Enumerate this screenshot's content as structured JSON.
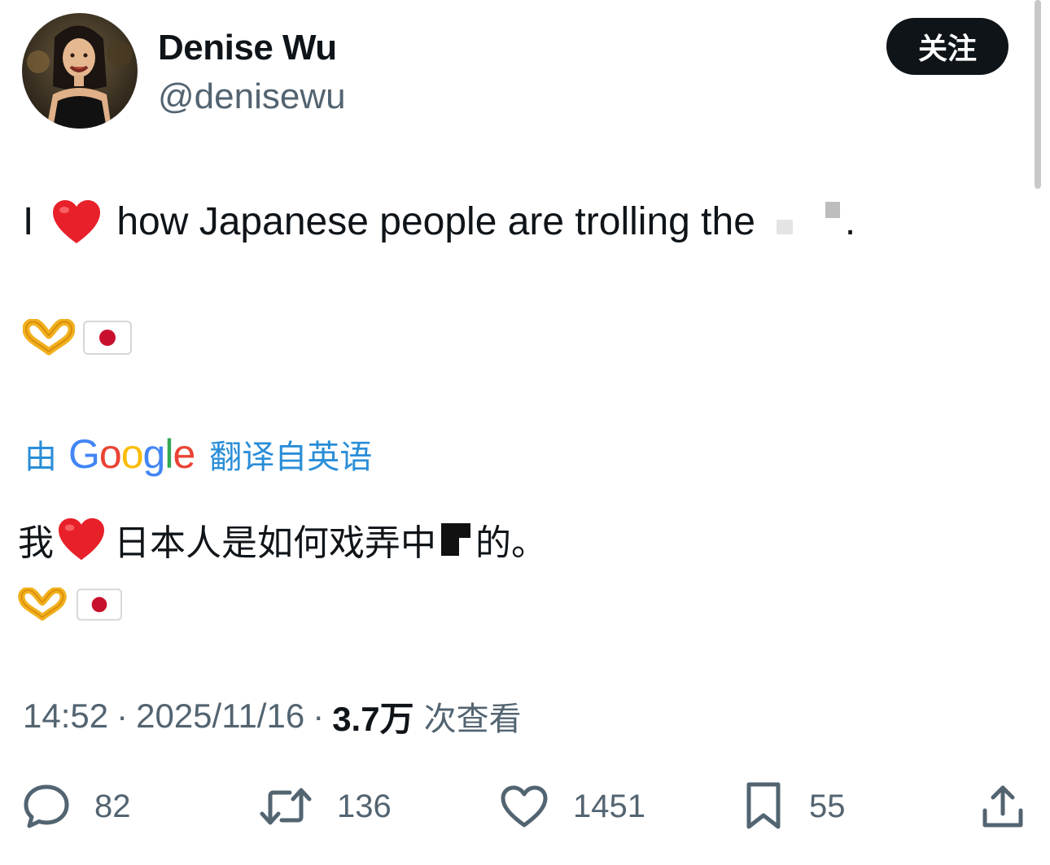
{
  "author": {
    "display_name": "Denise Wu",
    "handle": "@denisewu"
  },
  "follow_button": {
    "label": "关注"
  },
  "tweet": {
    "text_before_heart": "I",
    "text_after_heart": "how Japanese people are trolling the",
    "text_end": ".",
    "emoji_row_icons": [
      "heart-hands-emoji",
      "japan-flag-emoji"
    ]
  },
  "translation": {
    "prefix": "由",
    "provider": "Google",
    "suffix": "翻译自英语",
    "text_before_heart": "我",
    "text_after_heart": "日本人是如何戏弄中",
    "text_end": "的。"
  },
  "meta": {
    "time": "14:52",
    "date": "2025/11/16",
    "views_count": "3.7万",
    "views_label": "次查看"
  },
  "actions": {
    "replies": "82",
    "retweets": "136",
    "likes": "1451",
    "bookmarks": "55"
  },
  "colors": {
    "follow_bg": "#0f1419",
    "link_blue": "#2a8ed8",
    "secondary_text": "#536471",
    "heart_red": "#e8202a"
  }
}
